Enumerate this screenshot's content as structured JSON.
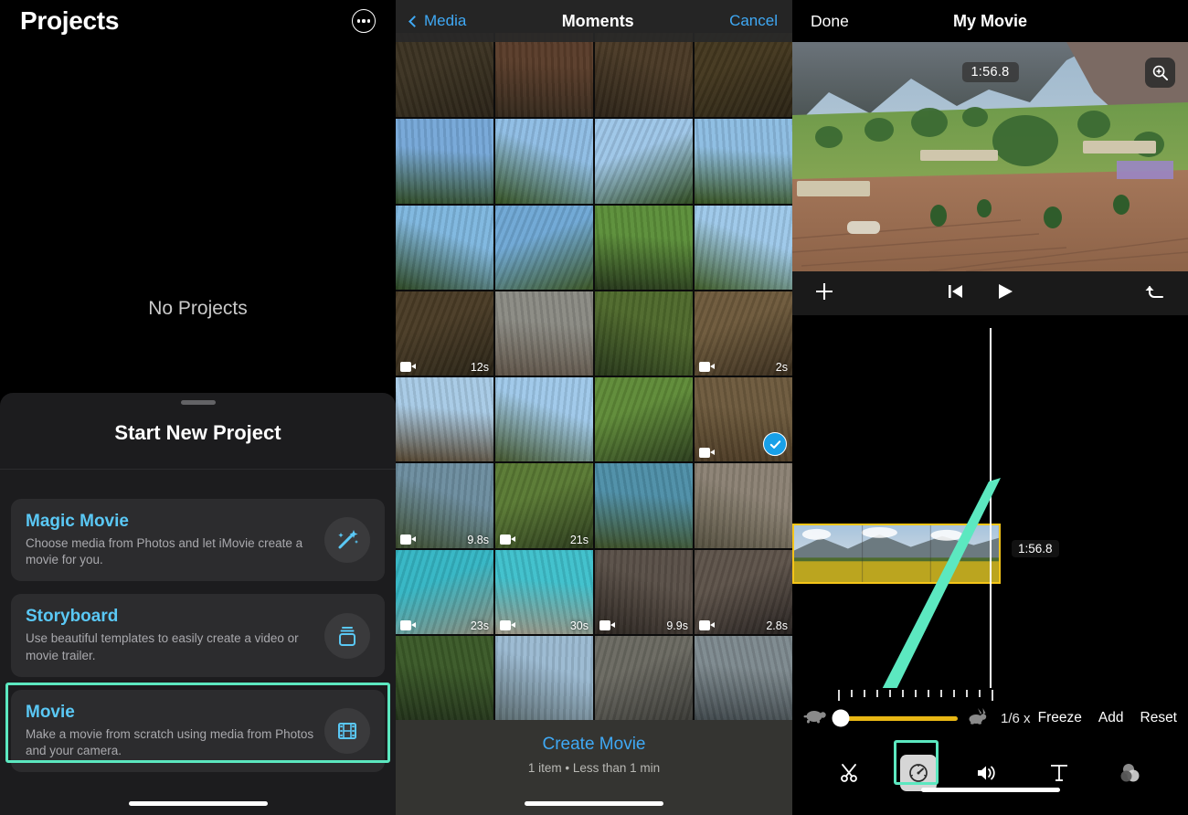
{
  "left_panel": {
    "title": "Projects",
    "more_icon": "more-options-icon",
    "empty_state": "No Projects",
    "sheet": {
      "title": "Start New Project",
      "options": [
        {
          "title": "Magic Movie",
          "desc": "Choose media from Photos and let iMovie create a movie for you.",
          "icon": "magic-wand-icon",
          "highlighted": false
        },
        {
          "title": "Storyboard",
          "desc": "Use beautiful templates to easily create a video or movie trailer.",
          "icon": "storyboard-stack-icon",
          "highlighted": false
        },
        {
          "title": "Movie",
          "desc": "Make a movie from scratch using media from Photos and your camera.",
          "icon": "film-strip-icon",
          "highlighted": true
        }
      ]
    }
  },
  "middle_panel": {
    "header": {
      "back_label": "Media",
      "title": "Moments",
      "cancel_label": "Cancel"
    },
    "grid": [
      {
        "dur": "",
        "video": false,
        "selected": false,
        "c1": "#3c3322",
        "c2": "#2a2318"
      },
      {
        "dur": "",
        "video": false,
        "selected": false,
        "c1": "#5a3d2a",
        "c2": "#33281c"
      },
      {
        "dur": "",
        "video": false,
        "selected": false,
        "c1": "#4a3a26",
        "c2": "#2c2318"
      },
      {
        "dur": "",
        "video": false,
        "selected": false,
        "c1": "#44381f",
        "c2": "#2a2315"
      },
      {
        "dur": "",
        "video": false,
        "selected": false,
        "c1": "#76a8d8",
        "c2": "#2f4a24"
      },
      {
        "dur": "",
        "video": false,
        "selected": false,
        "c1": "#8fbde4",
        "c2": "#33501f"
      },
      {
        "dur": "",
        "video": false,
        "selected": false,
        "c1": "#9ec6e8",
        "c2": "#2e4a1e"
      },
      {
        "dur": "",
        "video": false,
        "selected": false,
        "c1": "#8dbde2",
        "c2": "#35511f"
      },
      {
        "dur": "",
        "video": false,
        "selected": false,
        "c1": "#7fb7df",
        "c2": "#2b4520"
      },
      {
        "dur": "",
        "video": false,
        "selected": false,
        "c1": "#6fa8d5",
        "c2": "#3a5524"
      },
      {
        "dur": "",
        "video": false,
        "selected": false,
        "c1": "#5c8f3a",
        "c2": "#25361a"
      },
      {
        "dur": "",
        "video": false,
        "selected": false,
        "c1": "#9ec9ea",
        "c2": "#3d5a26"
      },
      {
        "dur": "12s",
        "video": true,
        "selected": false,
        "c1": "#4a3c26",
        "c2": "#2a2417"
      },
      {
        "dur": "",
        "video": false,
        "selected": false,
        "c1": "#8b8b84",
        "c2": "#5e5347"
      },
      {
        "dur": "",
        "video": false,
        "selected": false,
        "c1": "#4f6a2c",
        "c2": "#27371a"
      },
      {
        "dur": "2s",
        "video": true,
        "selected": false,
        "c1": "#6e5a3c",
        "c2": "#3a2e1e"
      },
      {
        "dur": "",
        "video": false,
        "selected": false,
        "c1": "#a8cbe6",
        "c2": "#54442e"
      },
      {
        "dur": "",
        "video": false,
        "selected": false,
        "c1": "#9fc9ea",
        "c2": "#41542a"
      },
      {
        "dur": "",
        "video": false,
        "selected": false,
        "c1": "#5f8b38",
        "c2": "#2c3e1d"
      },
      {
        "dur": "",
        "video": true,
        "selected": true,
        "c1": "#6e5b3e",
        "c2": "#4c3b25"
      },
      {
        "dur": "9.8s",
        "video": true,
        "selected": false,
        "c1": "#6d8ea0",
        "c2": "#3a4a2b"
      },
      {
        "dur": "21s",
        "video": true,
        "selected": false,
        "c1": "#5a7a34",
        "c2": "#2b3a1c"
      },
      {
        "dur": "",
        "video": false,
        "selected": false,
        "c1": "#4e8fa8",
        "c2": "#3c4f26"
      },
      {
        "dur": "",
        "video": false,
        "selected": false,
        "c1": "#8c8274",
        "c2": "#55503f"
      },
      {
        "dur": "23s",
        "video": true,
        "selected": false,
        "c1": "#35b6c4",
        "c2": "#8d8a7a"
      },
      {
        "dur": "30s",
        "video": true,
        "selected": false,
        "c1": "#3fc0cc",
        "c2": "#9a9484"
      },
      {
        "dur": "9.9s",
        "video": true,
        "selected": false,
        "c1": "#5a5048",
        "c2": "#2a241f"
      },
      {
        "dur": "2.8s",
        "video": true,
        "selected": false,
        "c1": "#5e534a",
        "c2": "#272220"
      },
      {
        "dur": "",
        "video": false,
        "selected": false,
        "c1": "#3b5a28",
        "c2": "#22321a"
      },
      {
        "dur": "",
        "video": false,
        "selected": false,
        "c1": "#9bbad2",
        "c2": "#5a6a6e"
      },
      {
        "dur": "",
        "video": false,
        "selected": false,
        "c1": "#6b6a62",
        "c2": "#3a3a36"
      },
      {
        "dur": "",
        "video": false,
        "selected": false,
        "c1": "#7e8a8f",
        "c2": "#40484c"
      }
    ],
    "footer": {
      "create_label": "Create Movie",
      "summary": "1 item • Less than 1 min"
    }
  },
  "right_panel": {
    "header": {
      "done_label": "Done",
      "title": "My Movie"
    },
    "preview": {
      "timecode": "1:56.8",
      "zoom_icon": "zoom-in-icon"
    },
    "timeline_toolbar": {
      "add_icon": "plus-icon",
      "skip_back_icon": "skip-to-start-icon",
      "play_icon": "play-icon",
      "undo_icon": "undo-icon"
    },
    "timeline": {
      "clip_timecode": "1:56.8"
    },
    "speed": {
      "slow_icon": "turtle-icon",
      "fast_icon": "rabbit-icon",
      "value": "1/6 x",
      "freeze_label": "Freeze",
      "add_label": "Add",
      "reset_label": "Reset"
    },
    "tabs": [
      {
        "icon": "scissors-icon",
        "name": "trim-tab",
        "active": false
      },
      {
        "icon": "speedometer-icon",
        "name": "speed-tab",
        "active": true
      },
      {
        "icon": "volume-icon",
        "name": "volume-tab",
        "active": false
      },
      {
        "icon": "text-icon",
        "name": "title-tab",
        "active": false
      },
      {
        "icon": "filters-icon",
        "name": "filters-tab",
        "active": false
      }
    ]
  },
  "annotations": {
    "accent_color": "#5CE8C0",
    "arrow": "pointer-arrow-to-speed-slider"
  }
}
